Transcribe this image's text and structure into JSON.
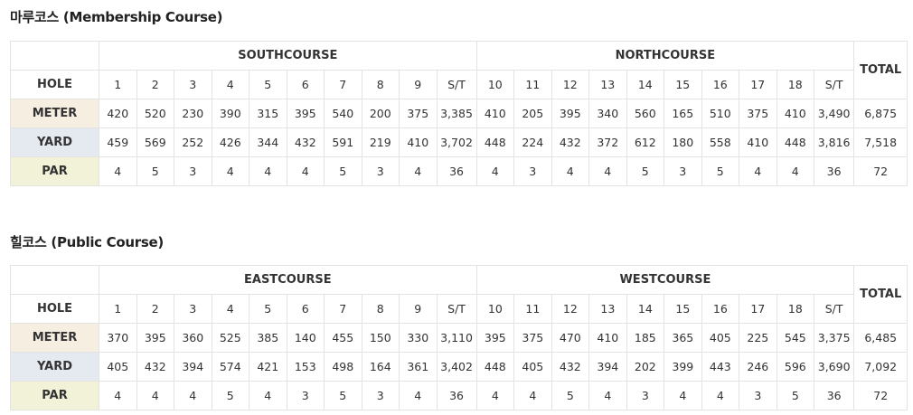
{
  "courses": [
    {
      "title": "마루코스 (Membership Course)",
      "front_name": "SOUTHCOURSE",
      "back_name": "NORTHCOURSE",
      "total_label": "TOTAL",
      "row_labels": {
        "hole": "HOLE",
        "meter": "METER",
        "yard": "YARD",
        "par": "PAR"
      },
      "holes": [
        "1",
        "2",
        "3",
        "4",
        "5",
        "6",
        "7",
        "8",
        "9",
        "S/T",
        "10",
        "11",
        "12",
        "13",
        "14",
        "15",
        "16",
        "17",
        "18",
        "S/T"
      ],
      "meter": [
        "420",
        "520",
        "230",
        "390",
        "315",
        "395",
        "540",
        "200",
        "375",
        "3,385",
        "410",
        "205",
        "395",
        "340",
        "560",
        "165",
        "510",
        "375",
        "410",
        "3,490",
        "6,875"
      ],
      "yard": [
        "459",
        "569",
        "252",
        "426",
        "344",
        "432",
        "591",
        "219",
        "410",
        "3,702",
        "448",
        "224",
        "432",
        "372",
        "612",
        "180",
        "558",
        "410",
        "448",
        "3,816",
        "7,518"
      ],
      "par": [
        "4",
        "5",
        "3",
        "4",
        "4",
        "4",
        "5",
        "3",
        "4",
        "36",
        "4",
        "3",
        "4",
        "4",
        "5",
        "3",
        "5",
        "4",
        "4",
        "36",
        "72"
      ]
    },
    {
      "title": "힐코스 (Public Course)",
      "front_name": "EASTCOURSE",
      "back_name": "WESTCOURSE",
      "total_label": "TOTAL",
      "row_labels": {
        "hole": "HOLE",
        "meter": "METER",
        "yard": "YARD",
        "par": "PAR"
      },
      "holes": [
        "1",
        "2",
        "3",
        "4",
        "5",
        "6",
        "7",
        "8",
        "9",
        "S/T",
        "10",
        "11",
        "12",
        "13",
        "14",
        "15",
        "16",
        "17",
        "18",
        "S/T"
      ],
      "meter": [
        "370",
        "395",
        "360",
        "525",
        "385",
        "140",
        "455",
        "150",
        "330",
        "3,110",
        "395",
        "375",
        "470",
        "410",
        "185",
        "365",
        "405",
        "225",
        "545",
        "3,375",
        "6,485"
      ],
      "yard": [
        "405",
        "432",
        "394",
        "574",
        "421",
        "153",
        "498",
        "164",
        "361",
        "3,402",
        "448",
        "405",
        "432",
        "394",
        "202",
        "399",
        "443",
        "246",
        "596",
        "3,690",
        "7,092"
      ],
      "par": [
        "4",
        "4",
        "4",
        "5",
        "4",
        "3",
        "5",
        "3",
        "4",
        "36",
        "4",
        "4",
        "5",
        "4",
        "3",
        "4",
        "4",
        "3",
        "5",
        "36",
        "72"
      ]
    }
  ],
  "colors": {
    "meter_bg": "#f7eee2",
    "yard_bg": "#e5eaf0",
    "par_bg": "#f2f2d9",
    "border": "#e3e3e3"
  }
}
